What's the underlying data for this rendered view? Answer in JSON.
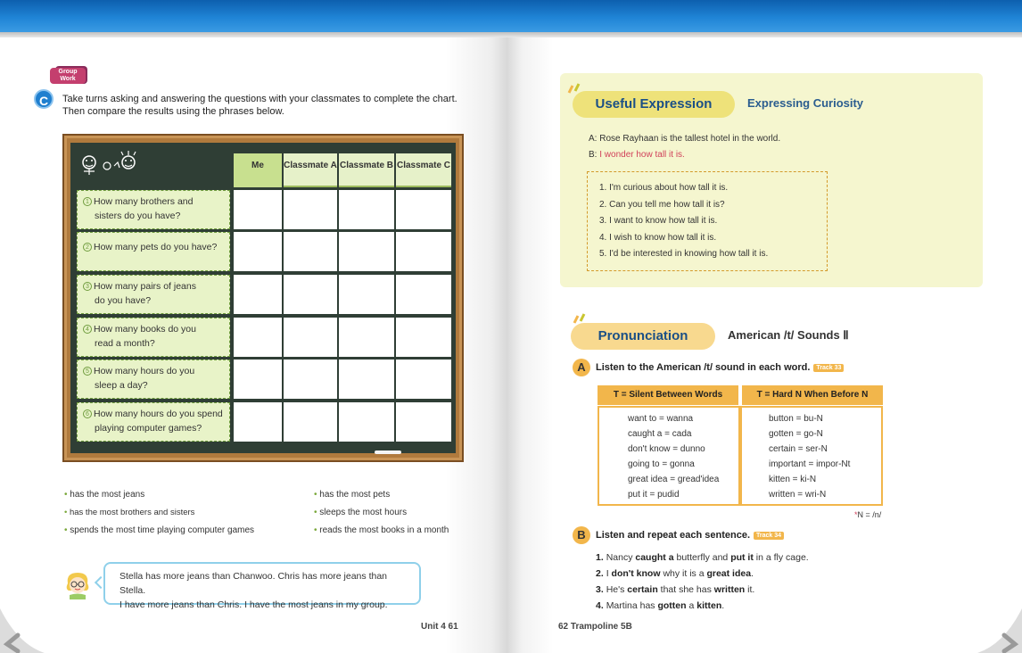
{
  "left_page": {
    "badge": {
      "line1": "Group",
      "line2": "Work"
    },
    "section_letter": "C",
    "instructions": "Take turns asking and answering the questions with your classmates to complete the chart. Then compare the results using the phrases below.",
    "chart": {
      "columns": [
        "Me",
        "Classmate A",
        "Classmate B",
        "Classmate C"
      ],
      "questions": [
        {
          "num": "1",
          "line1": "How many brothers and",
          "line2": "sisters do you have?"
        },
        {
          "num": "2",
          "line1": "How many pets do you have?",
          "line2": ""
        },
        {
          "num": "3",
          "line1": "How many pairs of jeans",
          "line2": "do you have?"
        },
        {
          "num": "4",
          "line1": "How many books do you",
          "line2": "read a month?"
        },
        {
          "num": "5",
          "line1": "How many hours do you",
          "line2": "sleep a day?"
        },
        {
          "num": "6",
          "line1": "How many hours do you spend",
          "line2": "playing computer games?"
        }
      ]
    },
    "phrases": {
      "col1": [
        "has the most jeans",
        "has the most brothers and sisters",
        "spends the most time playing computer games"
      ],
      "col2": [
        "has the most pets",
        "sleeps the most hours",
        "reads the most books in a month"
      ]
    },
    "speech": {
      "line1": "Stella has more jeans than Chanwoo. Chris has more jeans than Stella.",
      "line2": "I have more jeans than Chris. I have the most jeans in my group."
    },
    "page_number": "Unit 4  61"
  },
  "right_page": {
    "useful_expression": {
      "title": "Useful Expression",
      "subtitle": "Expressing Curiosity",
      "line_a": "A: Rose Rayhaan is the tallest hotel in the world.",
      "line_b_prefix": "B: ",
      "line_b_red": "I wonder how tall it is.",
      "options": [
        "1. I'm curious about how tall it is.",
        "2. Can you tell me how tall it is?",
        "3. I want to know how tall it is.",
        "4. I wish to know how tall it is.",
        "5. I'd be interested in knowing how tall it is."
      ]
    },
    "pronunciation": {
      "title": "Pronunciation",
      "subtitle": "American /t/ Sounds Ⅱ",
      "task_a": {
        "letter": "A",
        "text": "Listen to the American /t/ sound in each word.",
        "track": "Track 33"
      },
      "table": {
        "left_header": "T = Silent Between Words",
        "right_header": "T = Hard N When Before N",
        "left_items": [
          "want to = wanna",
          "caught a = cada",
          "don't know = dunno",
          "going to = gonna",
          "great idea = gread'idea",
          "put it = pudid"
        ],
        "right_items": [
          "button = bu-N",
          "gotten = go-N",
          "certain = ser-N",
          "important = impor-Nt",
          "kitten = ki-N",
          "written = wri-N"
        ]
      },
      "note": "N = /n/",
      "task_b": {
        "letter": "B",
        "text": "Listen and repeat each sentence.",
        "track": "Track 34"
      },
      "sentences": [
        {
          "n": "1.",
          "a": "Nancy ",
          "b": "caught a",
          "c": " butterfly and ",
          "d": "put it",
          "e": " in a fly cage."
        },
        {
          "n": "2.",
          "a": "I ",
          "b": "don't know",
          "c": " why it is a ",
          "d": "great idea",
          "e": "."
        },
        {
          "n": "3.",
          "a": "He's ",
          "b": "certain",
          "c": " that she has ",
          "d": "written",
          "e": " it."
        },
        {
          "n": "4.",
          "a": "Martina has ",
          "b": "gotten",
          "c": " a ",
          "d": "kitten",
          "e": "."
        }
      ]
    },
    "page_number": "62  Trampoline 5B"
  },
  "colors": {
    "blue_bar": "#1f84d6",
    "board": "#2f3e35",
    "frame": "#b07a3d",
    "accent_orange": "#f2b64b",
    "accent_red": "#d0415a"
  }
}
